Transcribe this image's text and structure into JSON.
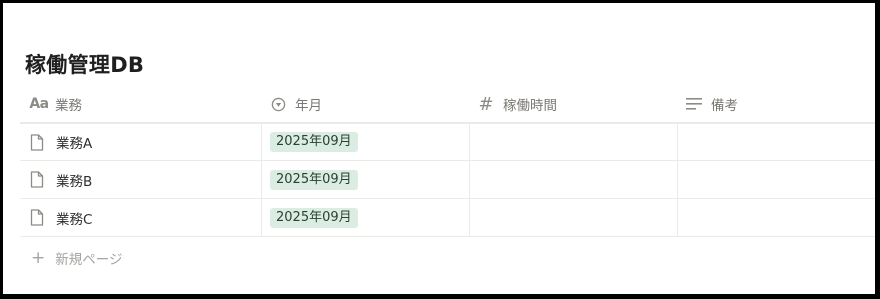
{
  "database": {
    "title": "稼働管理DB"
  },
  "columns": [
    {
      "icon": "text-property-icon",
      "icon_glyph": "Aa",
      "label": "業務"
    },
    {
      "icon": "status-circle-icon",
      "label": "年月"
    },
    {
      "icon": "number-hash-icon",
      "icon_glyph": "#",
      "label": "稼働時間"
    },
    {
      "icon": "lines-text-icon",
      "label": "備考"
    }
  ],
  "rows": [
    {
      "name": "業務A",
      "date": "2025年09月",
      "hours": "",
      "note": ""
    },
    {
      "name": "業務B",
      "date": "2025年09月",
      "hours": "",
      "note": ""
    },
    {
      "name": "業務C",
      "date": "2025年09月",
      "hours": "",
      "note": ""
    }
  ],
  "new_page": {
    "icon_glyph": "+",
    "label": "新規ページ"
  },
  "colors": {
    "date_pill_bg": "#dbede2",
    "border": "#ebeae6",
    "muted_text": "#7a7873"
  }
}
